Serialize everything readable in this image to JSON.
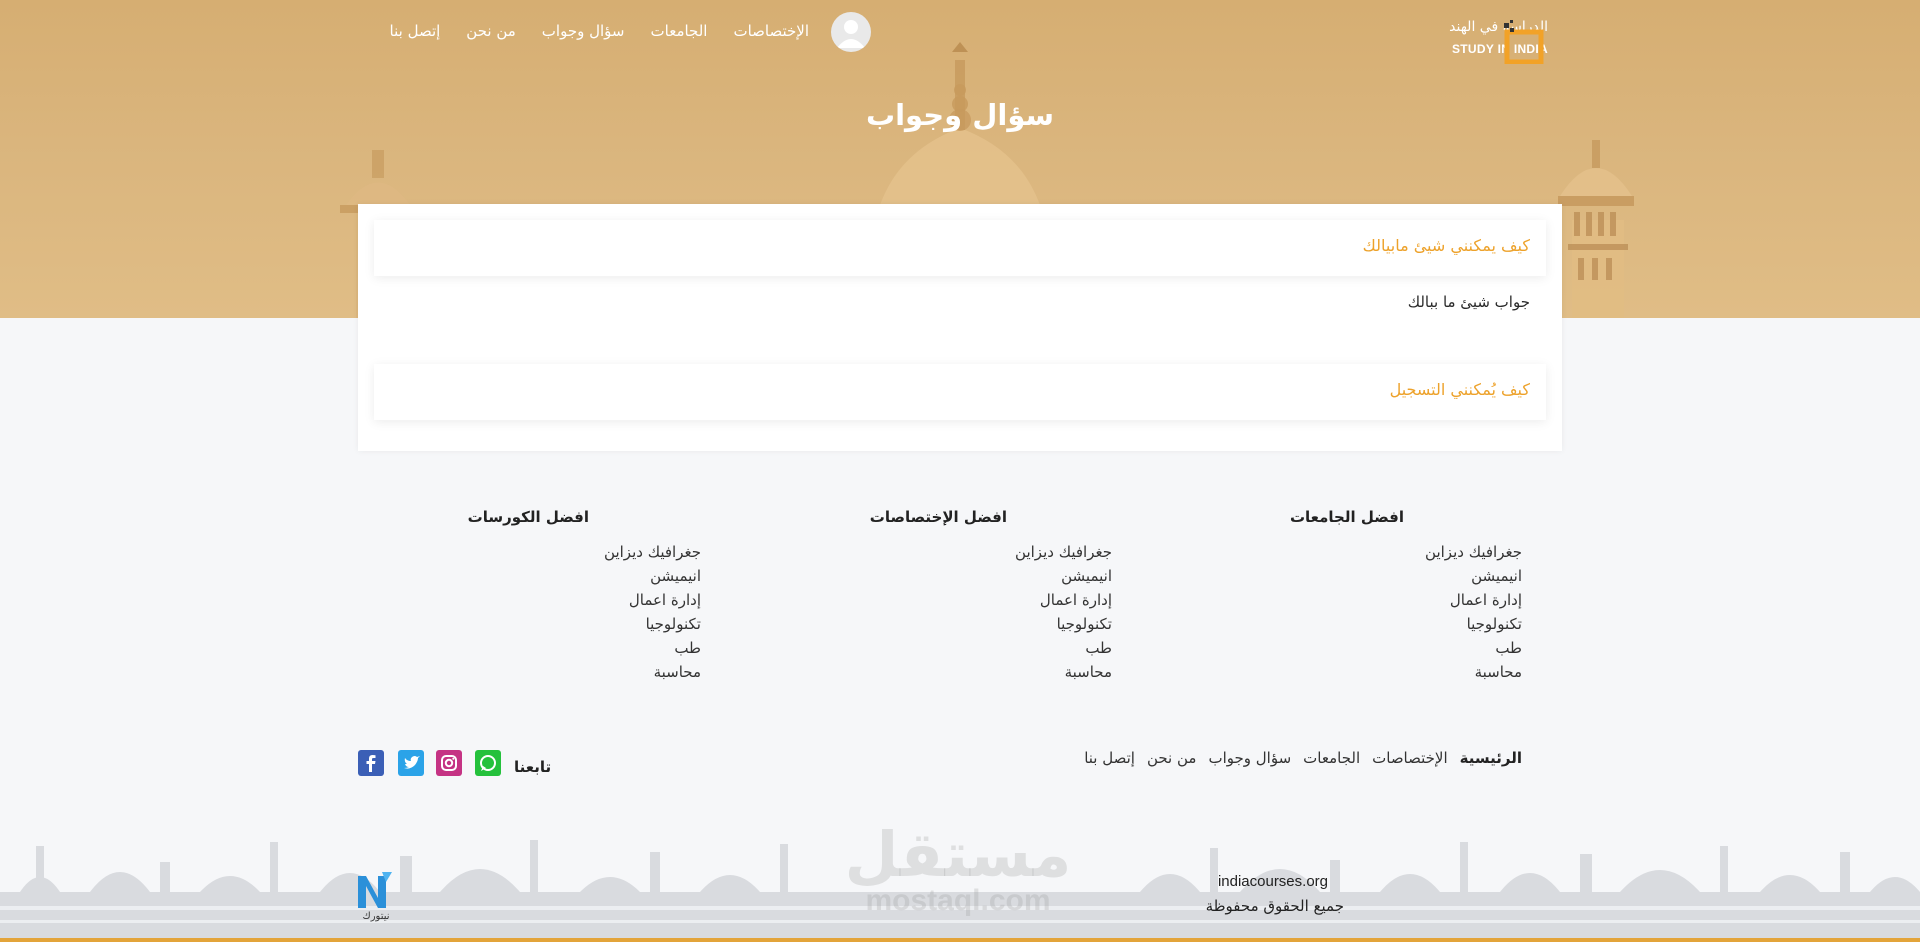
{
  "brand": {
    "name_ar": "الدراسة في الهند",
    "name_en": "STUDY IN INDIA",
    "accent": "#eda22b"
  },
  "nav": {
    "items": [
      "الإختصاصات",
      "الجامعات",
      "سؤال وجواب",
      "من نحن",
      "إتصل بنا"
    ]
  },
  "page": {
    "title": "سؤال وجواب"
  },
  "faq": [
    {
      "question": "كيف يمكنني شيئ مابيالك",
      "answer": "جواب شيئ ما ببالك"
    },
    {
      "question": "كيف يُمكنني التسجيل",
      "answer": ""
    }
  ],
  "footer": {
    "columns": [
      {
        "title": "افضل الجامعات",
        "items": [
          "جغرافيك ديزاين",
          "انيميشن",
          "إدارة اعمال",
          "تكنولوجيا",
          "طب",
          "محاسبة"
        ]
      },
      {
        "title": "افضل الإختصاصات",
        "items": [
          "جغرافيك ديزاين",
          "انيميشن",
          "إدارة اعمال",
          "تكنولوجيا",
          "طب",
          "محاسبة"
        ]
      },
      {
        "title": "افضل الكورسات",
        "items": [
          "جغرافيك ديزاين",
          "انيميشن",
          "إدارة اعمال",
          "تكنولوجيا",
          "طب",
          "محاسبة"
        ]
      }
    ],
    "links": [
      "الرئيسية",
      "الإختصاصات",
      "الجامعات",
      "سؤال وجواب",
      "من نحن",
      "إتصل بنا"
    ],
    "follow_label": "تابعنا",
    "social": [
      "whatsapp-icon",
      "instagram-icon",
      "twitter-icon",
      "facebook-icon"
    ],
    "site": "indiacourses.org",
    "copyright": "جميع الحقوق محفوظة",
    "developer": "نيتورك",
    "watermark": "مستقل",
    "watermark_sub": "mostaql.com"
  }
}
